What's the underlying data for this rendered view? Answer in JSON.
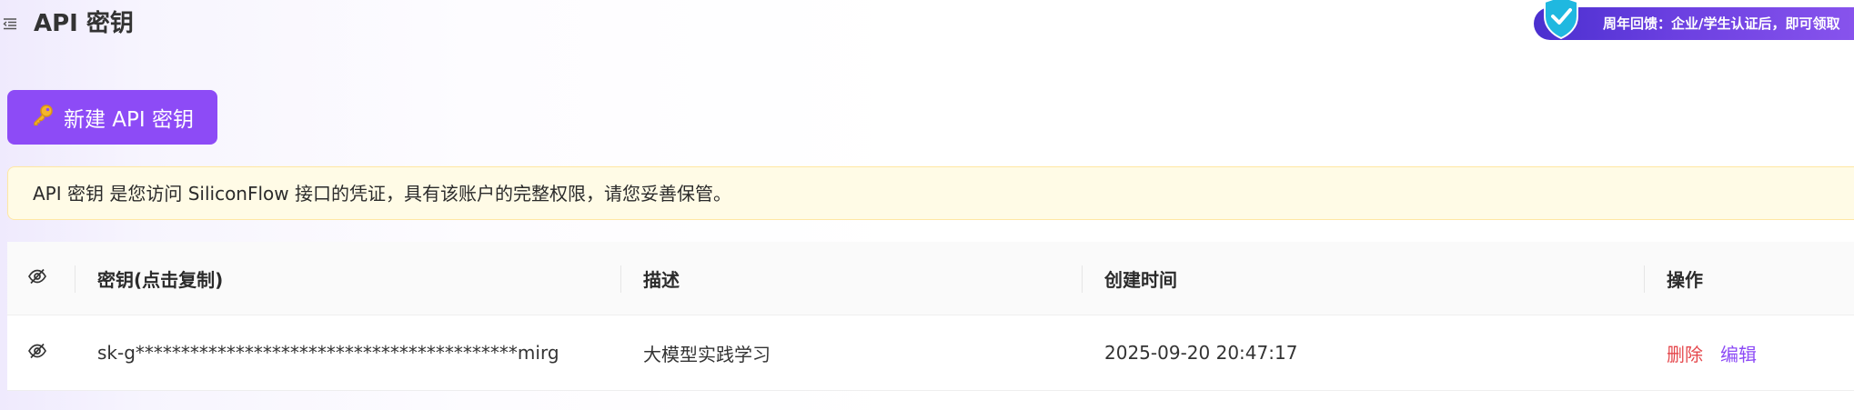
{
  "header": {
    "title": "API 密钥",
    "menu_icon": "menu-fold-icon"
  },
  "promo": {
    "text": "周年回馈：企业/学生认证后，即可领取",
    "badge_icon": "shield-check-icon",
    "colors": {
      "from": "#4a2fcf",
      "to": "#8a55ee"
    }
  },
  "toolbar": {
    "create_label": "新建 API 密钥",
    "create_icon": "key-icon"
  },
  "notice": {
    "text": "API 密钥 是您访问 SiliconFlow 接口的凭证，具有该账户的完整权限，请您妥善保管。"
  },
  "table": {
    "columns": {
      "visibility": "eye-off-icon",
      "key": "密钥(点击复制)",
      "description": "描述",
      "created": "创建时间",
      "actions": "操作"
    },
    "rows": [
      {
        "key": "sk-g******************************************mirg",
        "description": "大模型实践学习",
        "created": "2025-09-20 20:47:17",
        "delete_label": "删除",
        "edit_label": "编辑"
      }
    ]
  },
  "colors": {
    "accent": "#8d4bf6",
    "danger": "#e5484d",
    "notice_bg": "#fffbe6",
    "notice_border": "#ffe7a3"
  }
}
